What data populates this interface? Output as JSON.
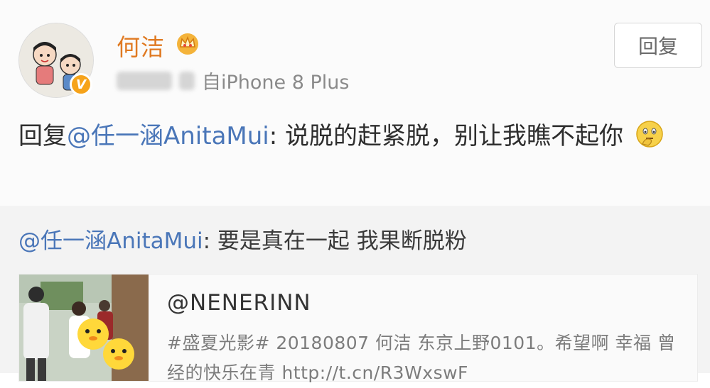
{
  "post": {
    "username": "何洁",
    "source": "自iPhone 8 Plus",
    "reply_button": "回复",
    "content": {
      "prefix": "回复",
      "mention": "@任一涵AnitaMui",
      "text": ": 说脱的赶紧脱，别让我瞧不起你"
    },
    "icons": {
      "avatar": "cartoon-avatar",
      "verified": "verified-badge-icon",
      "member": "crown-icon",
      "emoji": "thinking-emoji-icon"
    },
    "colors": {
      "username": "#e07a22",
      "mention": "#4a76b8",
      "verified_badge": "#f6a31a"
    }
  },
  "repost": {
    "mention": "@任一涵AnitaMui",
    "text": ": 要是真在一起 我果断脱粉",
    "card": {
      "title": "@NENERINN",
      "description": "#盛夏光影# 20180807 何洁 东京上野0101。希望啊 幸福 曾经的快乐在青 http://t.cn/R3WxswF"
    }
  }
}
